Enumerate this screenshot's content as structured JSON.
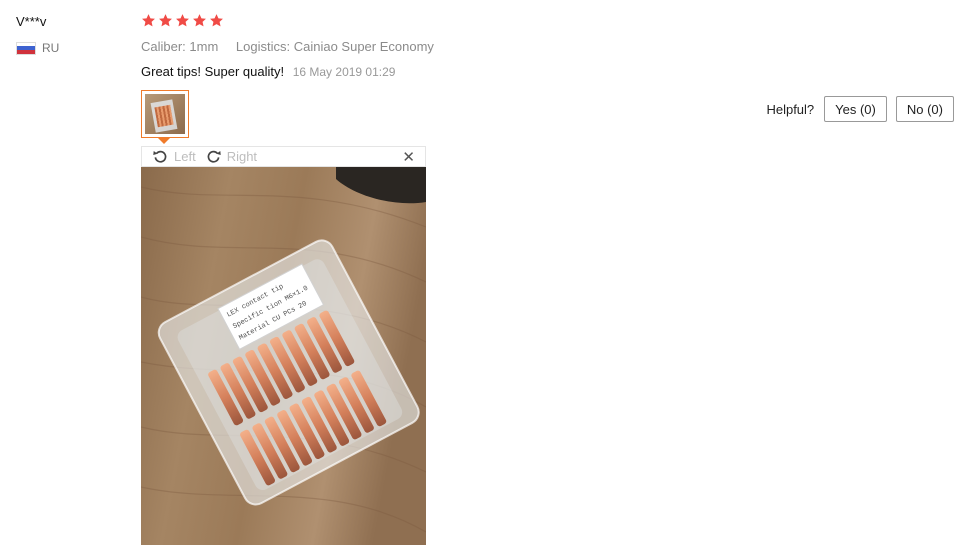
{
  "reviewer": {
    "name": "V***v",
    "country_code": "RU"
  },
  "rating": {
    "stars": 5,
    "max": 5,
    "color": "#f04b46"
  },
  "attributes": {
    "caliber": "Caliber: 1mm",
    "logistics": "Logistics: Cainiao Super Economy"
  },
  "feedback": {
    "text": "Great tips! Super quality!",
    "date": "16 May 2019 01:29"
  },
  "helpful": {
    "label": "Helpful?",
    "yes_label": "Yes (0)",
    "no_label": "No (0)"
  },
  "viewer": {
    "rotate_left_label": "Left",
    "rotate_right_label": "Right",
    "close_glyph": "✕"
  },
  "photo": {
    "label_lines": [
      "LEX contact tip",
      "Specific tion M6×1.0",
      "Material CU PCs 20"
    ]
  },
  "icons": [
    "star-icon",
    "russia-flag-icon",
    "rotate-left-icon",
    "rotate-right-icon",
    "close-icon"
  ],
  "colors": {
    "accent_orange": "#f07b2a",
    "star_red": "#f04b46",
    "muted_text": "#8b8b8b"
  }
}
